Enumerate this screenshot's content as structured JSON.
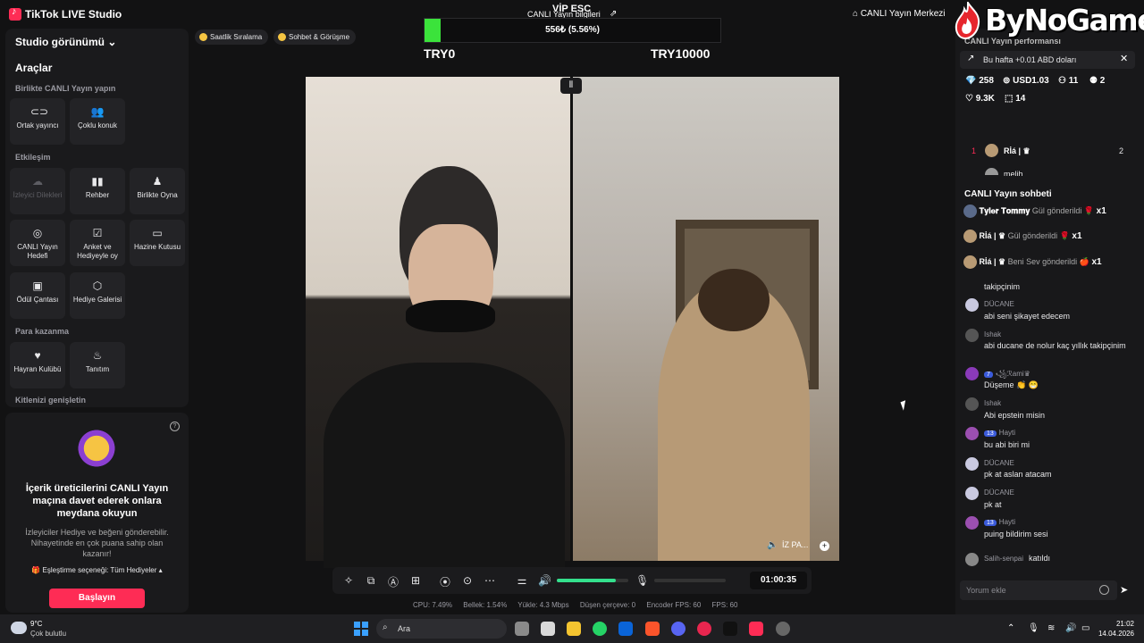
{
  "app": {
    "title": "TikTok LIVE Studio"
  },
  "topbar": {
    "vip_label": "VİP ESC",
    "center_title": "CANLI Yayın bilgileri",
    "live_center": "CANLI Yayın Merkezi"
  },
  "watermark": {
    "text": "ByNoGame"
  },
  "left": {
    "studio_view": "Studio görünümü",
    "tools": "Araçlar",
    "section_together": "Birlikte CANLI Yayın yapın",
    "tiles_together": [
      {
        "label": "Ortak yayıncı",
        "icon": "link-icon"
      },
      {
        "label": "Çoklu konuk",
        "icon": "users-icon"
      }
    ],
    "section_interaction": "Etkileşim",
    "tiles_interaction": [
      {
        "label": "İzleyici Dilekleri",
        "icon": "wish-icon"
      },
      {
        "label": "Rehber",
        "icon": "book-icon"
      },
      {
        "label": "Birlikte Oyna",
        "icon": "gamepad-icon"
      },
      {
        "label": "CANLI Yayın Hedefi",
        "icon": "target-icon"
      },
      {
        "label": "Anket ve Hediyeyle oy",
        "icon": "poll-icon"
      },
      {
        "label": "Hazine Kutusu",
        "icon": "chest-icon"
      },
      {
        "label": "Ödül Çantası",
        "icon": "bag-icon"
      },
      {
        "label": "Hediye Galerisi",
        "icon": "gift-icon"
      }
    ],
    "section_earn": "Para kazanma",
    "tiles_earn": [
      {
        "label": "Hayran Kulübü",
        "icon": "heart-icon"
      },
      {
        "label": "Tanıtım",
        "icon": "flame-icon"
      }
    ],
    "section_audience": "Kitlenizi genişletin"
  },
  "promo": {
    "title": "İçerik üreticilerini CANLI Yayın maçına davet ederek onlara meydana okuyun",
    "body": "İzleyiciler Hediye ve beğeni gönderebilir. Nihayetinde en çok puana sahip olan kazanır!",
    "match_option": "Eşleştirme seçeneği: Tüm Hediyeler",
    "button": "Başlayın"
  },
  "chips": [
    {
      "label": "Saatlik Sıralama"
    },
    {
      "label": "Sohbet & Görüşme"
    }
  ],
  "goal": {
    "text": "556₺ (5.56%)",
    "min": "TRY0",
    "max": "TRY10000",
    "progress": 0.0556,
    "color": "#3be33b"
  },
  "video": {
    "tag": "İZ PA..."
  },
  "controls": {
    "timer": "01:00:35",
    "volume_level": 0.82
  },
  "stats": [
    "CPU: 7.49%",
    "Bellek: 1.54%",
    "Yükle: 4.3 Mbps",
    "Düşen çerçeve: 0",
    "Encoder FPS: 60",
    "FPS: 60"
  ],
  "right": {
    "perf_title": "CANLI Yayın performansı",
    "alert": "Bu hafta +0.01 ABD doları",
    "stats": [
      {
        "icon": "diamond-icon",
        "value": "258"
      },
      {
        "icon": "coin-icon",
        "value": "USD1.03"
      },
      {
        "icon": "viewers-icon",
        "value": "11"
      },
      {
        "icon": "user-add-icon",
        "value": "2"
      },
      {
        "icon": "like-icon",
        "value": "9.3K"
      },
      {
        "icon": "gift-icon",
        "value": "14"
      }
    ],
    "ranking": [
      {
        "rank": "1",
        "name": "Rİá | ♛",
        "score": "2"
      },
      {
        "rank": "",
        "name": "melih",
        "score": ""
      }
    ],
    "chat_title": "CANLI Yayın sohbeti",
    "gifts": [
      {
        "user": "𝐓𝐲𝐥𝐞𝐫 𝐓𝐨𝐦𝐦𝐲",
        "action": "Gül gönderildi",
        "count": "x1"
      },
      {
        "user": "Rİá | ♛",
        "action": "Gül gönderildi",
        "count": "x1"
      },
      {
        "user": "Rİá | ♛",
        "action": "Beni Sev gönderildi",
        "count": "x1"
      }
    ],
    "messages": [
      {
        "name": "",
        "level": "",
        "text": "takipçinim"
      },
      {
        "name": "DÜCANE",
        "level": "",
        "text": "abi seni şikayet edecem"
      },
      {
        "name": "Ishak",
        "level": "",
        "text": "abi ducane de nolur kaç yıllık takipçinim"
      },
      {
        "name": "꧁ℛami♛",
        "level": "7",
        "text": "Düşeme 👏 😁"
      },
      {
        "name": "Ishak",
        "level": "",
        "text": "Abi epstein misin"
      },
      {
        "name": "Hayti",
        "level": "13",
        "text": "bu abi biri mi"
      },
      {
        "name": "DÜCANE",
        "level": "",
        "text": "pk at aslan atacam"
      },
      {
        "name": "DÜCANE",
        "level": "",
        "text": "pk at"
      },
      {
        "name": "Hayti",
        "level": "13",
        "text": "puing bildirim sesi"
      },
      {
        "name": "Salih-senpai",
        "level": "",
        "text": "katıldı"
      }
    ],
    "comment_placeholder": "Yorum ekle"
  },
  "taskbar": {
    "temp": "9°C",
    "weather": "Çok bulutlu",
    "search": "Ara",
    "time": "21:02",
    "date": "14.04.2026"
  }
}
